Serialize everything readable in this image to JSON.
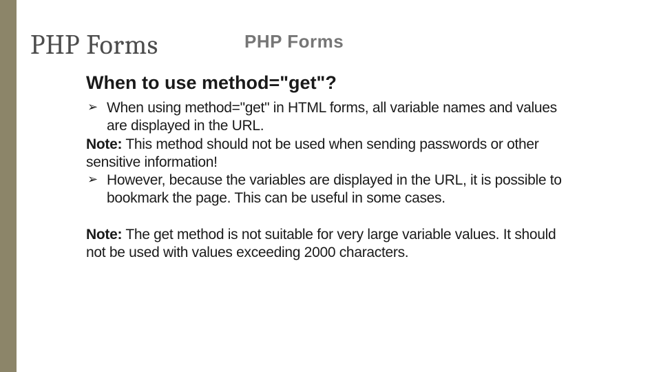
{
  "title": "PHP Forms",
  "watermark": "PHP Forms",
  "subhead": "When to use method=\"get\"?",
  "bullet1_a": "When using method=\"get\" in HTML forms, all variable names and values",
  "bullet1_b": "are displayed in the URL.",
  "note1_label": "Note:",
  "note1_a": " This method should not be used when sending passwords or other",
  "note1_b": " sensitive information!",
  "bullet2_a": "However, because the variables are displayed in the URL, it is possible to",
  "bullet2_b": "bookmark the page. This can be useful in some cases.",
  "note2_label": "Note:",
  "note2_a": " The get method is not suitable for very large variable values. It should",
  "note2_b": " not be used with values exceeding 2000 characters."
}
